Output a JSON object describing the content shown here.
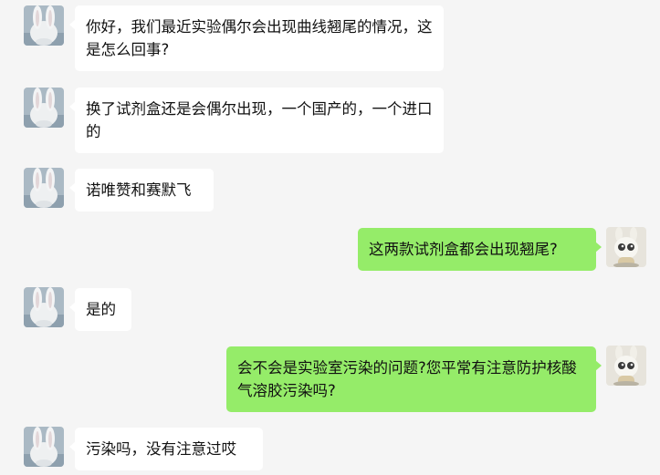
{
  "colors": {
    "background": "#f5f5f5",
    "incoming_bubble": "#ffffff",
    "outgoing_bubble": "#95ec69",
    "text": "#111111"
  },
  "avatars": {
    "contact": "white-rabbit-avatar",
    "me": "bunny-figurine-avatar"
  },
  "messages": [
    {
      "from": "contact",
      "text": "你好，我们最近实验偶尔会出现曲线翘尾的情况，这是怎么回事?"
    },
    {
      "from": "contact",
      "text": "换了试剂盒还是会偶尔出现，一个国产的，一个进口的"
    },
    {
      "from": "contact",
      "text": "诺唯赞和赛默飞"
    },
    {
      "from": "me",
      "text": "这两款试剂盒都会出现翘尾?"
    },
    {
      "from": "contact",
      "text": "是的"
    },
    {
      "from": "me",
      "text": "会不会是实验室污染的问题?您平常有注意防护核酸气溶胶污染吗?"
    },
    {
      "from": "contact",
      "text": "污染吗，没有注意过哎"
    }
  ]
}
